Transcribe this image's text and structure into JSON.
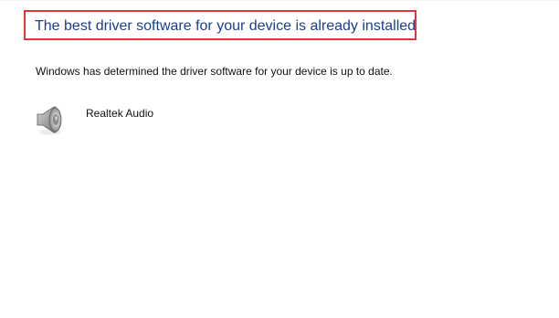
{
  "header": {
    "title": "The best driver software for your device is already installed"
  },
  "body": {
    "message": "Windows has determined the driver software for your device is up to date."
  },
  "device": {
    "name": "Realtek Audio",
    "icon": "speaker-icon"
  },
  "colors": {
    "title": "#1b3f8a",
    "highlight_border": "#e0363b"
  }
}
